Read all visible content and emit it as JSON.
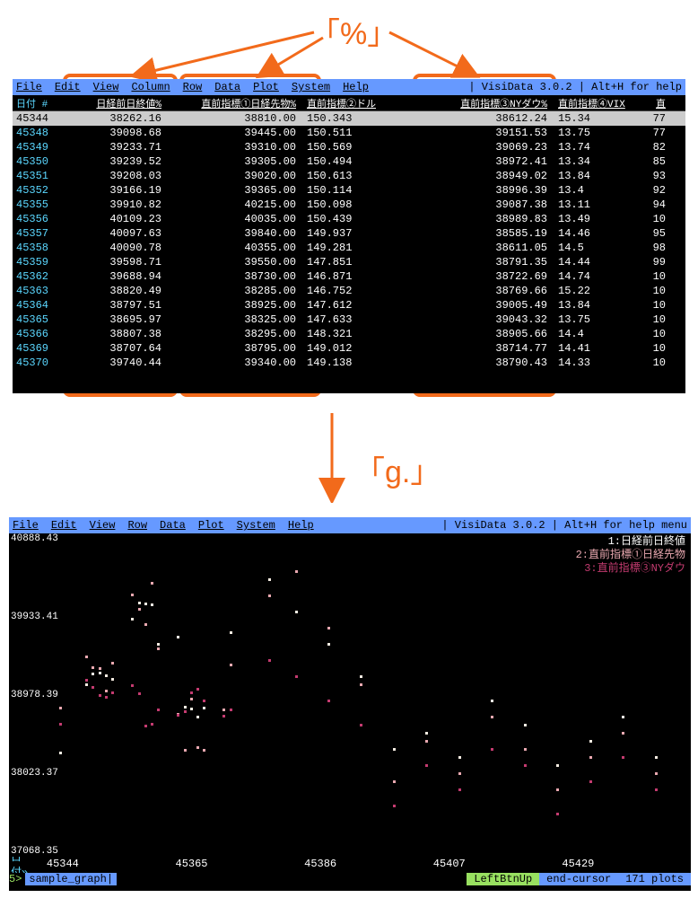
{
  "annotations": {
    "percent_label": "「%」",
    "gdot_label": "「g.」"
  },
  "top_panel": {
    "menubar": {
      "items": [
        "File",
        "Edit",
        "View",
        "Column",
        "Row",
        "Data",
        "Plot",
        "System",
        "Help"
      ],
      "right": "| VisiData 3.0.2 | Alt+H for help"
    },
    "columns": {
      "date": "日付 #",
      "c1": "日経前日終値%",
      "c2": "直前指標①日経先物%",
      "c3": "直前指標②ドル",
      "c4": "直前指標③NYダウ%",
      "c5": "直前指標④VIX",
      "c6": "直"
    },
    "rows": [
      {
        "date": "45344",
        "c1": "38262.16",
        "c2": "38810.00",
        "c3": "150.343",
        "c4": "38612.24",
        "c5": "15.34",
        "c6": "77"
      },
      {
        "date": "45348",
        "c1": "39098.68",
        "c2": "39445.00",
        "c3": "150.511",
        "c4": "39151.53",
        "c5": "13.75",
        "c6": "77"
      },
      {
        "date": "45349",
        "c1": "39233.71",
        "c2": "39310.00",
        "c3": "150.569",
        "c4": "39069.23",
        "c5": "13.74",
        "c6": "82"
      },
      {
        "date": "45350",
        "c1": "39239.52",
        "c2": "39305.00",
        "c3": "150.494",
        "c4": "38972.41",
        "c5": "13.34",
        "c6": "85"
      },
      {
        "date": "45351",
        "c1": "39208.03",
        "c2": "39020.00",
        "c3": "150.613",
        "c4": "38949.02",
        "c5": "13.84",
        "c6": "93"
      },
      {
        "date": "45352",
        "c1": "39166.19",
        "c2": "39365.00",
        "c3": "150.114",
        "c4": "38996.39",
        "c5": "13.4",
        "c6": "92"
      },
      {
        "date": "45355",
        "c1": "39910.82",
        "c2": "40215.00",
        "c3": "150.098",
        "c4": "39087.38",
        "c5": "13.11",
        "c6": "94"
      },
      {
        "date": "45356",
        "c1": "40109.23",
        "c2": "40035.00",
        "c3": "150.439",
        "c4": "38989.83",
        "c5": "13.49",
        "c6": "10"
      },
      {
        "date": "45357",
        "c1": "40097.63",
        "c2": "39840.00",
        "c3": "149.937",
        "c4": "38585.19",
        "c5": "14.46",
        "c6": "95"
      },
      {
        "date": "45358",
        "c1": "40090.78",
        "c2": "40355.00",
        "c3": "149.281",
        "c4": "38611.05",
        "c5": "14.5",
        "c6": "98"
      },
      {
        "date": "45359",
        "c1": "39598.71",
        "c2": "39550.00",
        "c3": "147.851",
        "c4": "38791.35",
        "c5": "14.44",
        "c6": "99"
      },
      {
        "date": "45362",
        "c1": "39688.94",
        "c2": "38730.00",
        "c3": "146.871",
        "c4": "38722.69",
        "c5": "14.74",
        "c6": "10"
      },
      {
        "date": "45363",
        "c1": "38820.49",
        "c2": "38285.00",
        "c3": "146.752",
        "c4": "38769.66",
        "c5": "15.22",
        "c6": "10"
      },
      {
        "date": "45364",
        "c1": "38797.51",
        "c2": "38925.00",
        "c3": "147.612",
        "c4": "39005.49",
        "c5": "13.84",
        "c6": "10"
      },
      {
        "date": "45365",
        "c1": "38695.97",
        "c2": "38325.00",
        "c3": "147.633",
        "c4": "39043.32",
        "c5": "13.75",
        "c6": "10"
      },
      {
        "date": "45366",
        "c1": "38807.38",
        "c2": "38295.00",
        "c3": "148.321",
        "c4": "38905.66",
        "c5": "14.4",
        "c6": "10"
      },
      {
        "date": "45369",
        "c1": "38707.64",
        "c2": "38795.00",
        "c3": "149.012",
        "c4": "38714.77",
        "c5": "14.41",
        "c6": "10"
      },
      {
        "date": "45370",
        "c1": "39740.44",
        "c2": "39340.00",
        "c3": "149.138",
        "c4": "38790.43",
        "c5": "14.33",
        "c6": "10"
      }
    ]
  },
  "bottom_panel": {
    "menubar": {
      "items": [
        "File",
        "Edit",
        "View",
        "Row",
        "Data",
        "Plot",
        "System",
        "Help"
      ],
      "right": "| VisiData 3.0.2 | Alt+H for help menu"
    },
    "legend": {
      "l1": "1:日経前日終値",
      "l2": "2:直前指標①日経先物",
      "l3": "3:直前指標③NYダウ"
    },
    "yticks": [
      "40888.43",
      "39933.41",
      "38978.39",
      "38023.37",
      "37068.35"
    ],
    "xaxis_label": "日付»",
    "xticks": [
      "45344",
      "45365",
      "45386",
      "45407",
      "45429"
    ],
    "status": {
      "prefix": "5>",
      "filename": "sample_graph|",
      "leftbtn": "LeftBtnUp",
      "command": "end-cursor",
      "plots": "171 plots"
    }
  },
  "chart_data": {
    "type": "scatter",
    "title": "",
    "xlabel": "日付",
    "ylabel": "",
    "xlim": [
      45344,
      45440
    ],
    "ylim": [
      37068.35,
      40888.43
    ],
    "series": [
      {
        "name": "日経前日終値",
        "x": [
          45344,
          45348,
          45349,
          45350,
          45351,
          45352,
          45355,
          45356,
          45357,
          45358,
          45359,
          45362,
          45363,
          45364,
          45365,
          45366,
          45369,
          45370,
          45376,
          45380,
          45385,
          45390,
          45395,
          45400,
          45405,
          45410,
          45415,
          45420,
          45425,
          45430,
          45435
        ],
        "values": [
          38262,
          39099,
          39234,
          39240,
          39208,
          39166,
          39911,
          40109,
          40098,
          40091,
          39599,
          39689,
          38820,
          38798,
          38696,
          38807,
          38708,
          39740,
          40400,
          40000,
          39600,
          39200,
          38300,
          38500,
          38200,
          38900,
          38600,
          38100,
          38400,
          38700,
          38200
        ]
      },
      {
        "name": "直前指標①日経先物",
        "x": [
          45344,
          45348,
          45349,
          45350,
          45351,
          45352,
          45355,
          45356,
          45357,
          45358,
          45359,
          45362,
          45363,
          45364,
          45365,
          45366,
          45369,
          45370,
          45376,
          45380,
          45385,
          45390,
          45395,
          45400,
          45405,
          45410,
          45415,
          45420,
          45425,
          45430,
          45435
        ],
        "values": [
          38810,
          39445,
          39310,
          39305,
          39020,
          39365,
          40215,
          40035,
          39840,
          40355,
          39550,
          38730,
          38285,
          38925,
          38325,
          38295,
          38795,
          39340,
          40200,
          40500,
          39800,
          39100,
          37900,
          38400,
          38000,
          38700,
          38300,
          37800,
          38200,
          38500,
          38000
        ]
      },
      {
        "name": "直前指標③NYダウ",
        "x": [
          45344,
          45348,
          45349,
          45350,
          45351,
          45352,
          45355,
          45356,
          45357,
          45358,
          45359,
          45362,
          45363,
          45364,
          45365,
          45366,
          45369,
          45370,
          45376,
          45380,
          45385,
          45390,
          45395,
          45400,
          45405,
          45410,
          45415,
          45420,
          45425,
          45430,
          45435
        ],
        "values": [
          38612,
          39152,
          39069,
          38972,
          38949,
          38996,
          39087,
          38990,
          38585,
          38611,
          38791,
          38723,
          38770,
          39005,
          39043,
          38906,
          38715,
          38790,
          39400,
          39200,
          38900,
          38600,
          37600,
          38100,
          37800,
          38300,
          38100,
          37500,
          37900,
          38200,
          37800
        ]
      }
    ]
  }
}
